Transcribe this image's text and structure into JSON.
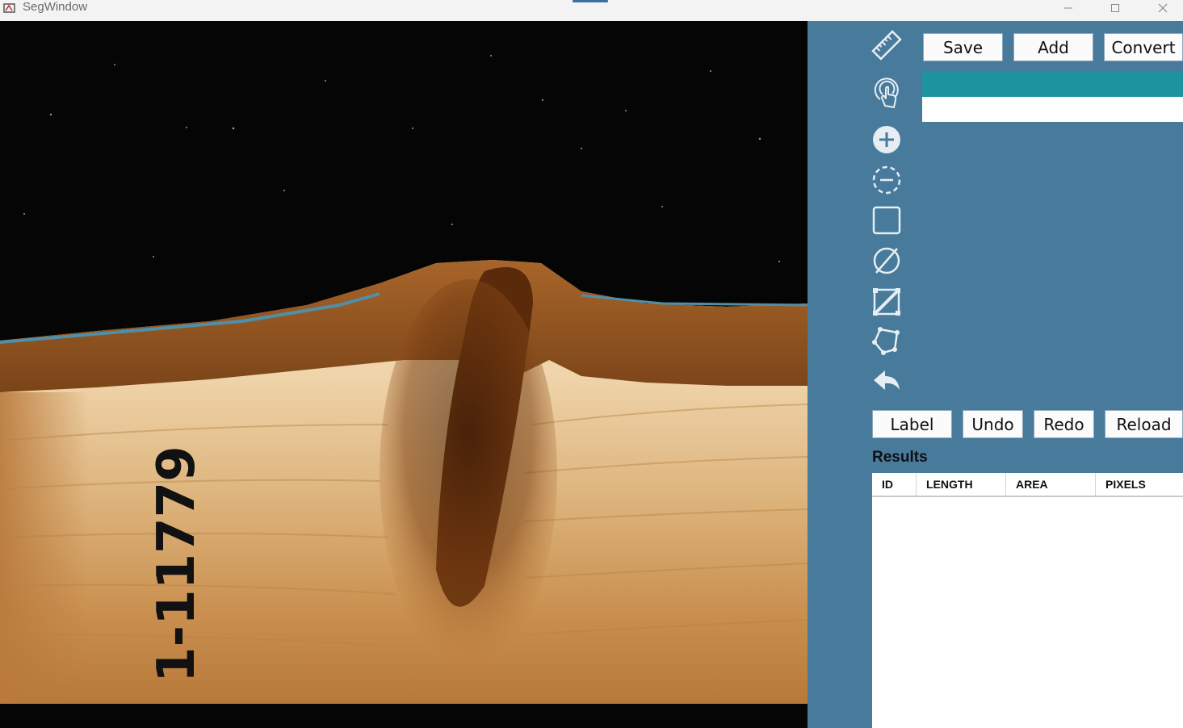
{
  "window": {
    "title": "SegWindow",
    "controls": [
      "minimize-icon",
      "maximize-icon",
      "close-icon"
    ]
  },
  "image_viewer": {
    "sample_label": "1-11779"
  },
  "tools": [
    {
      "name": "ruler-icon"
    },
    {
      "name": "touch-icon"
    },
    {
      "name": "add-circle-icon"
    },
    {
      "name": "remove-circle-dashed-icon"
    },
    {
      "name": "rectangle-icon"
    },
    {
      "name": "empty-set-icon"
    },
    {
      "name": "diagonal-box-icon"
    },
    {
      "name": "polygon-icon"
    },
    {
      "name": "undo-arrow-icon"
    }
  ],
  "top_buttons": {
    "save": "Save",
    "add": "Add",
    "convert": "Convert"
  },
  "bottom_buttons": {
    "label": "Label",
    "undo": "Undo",
    "redo": "Redo",
    "reload": "Reload"
  },
  "results": {
    "title": "Results",
    "columns": [
      "ID",
      "LENGTH",
      "AREA",
      "PIXELS"
    ]
  },
  "colors": {
    "panel": "#477a9b",
    "selected_row": "#1d939f"
  }
}
